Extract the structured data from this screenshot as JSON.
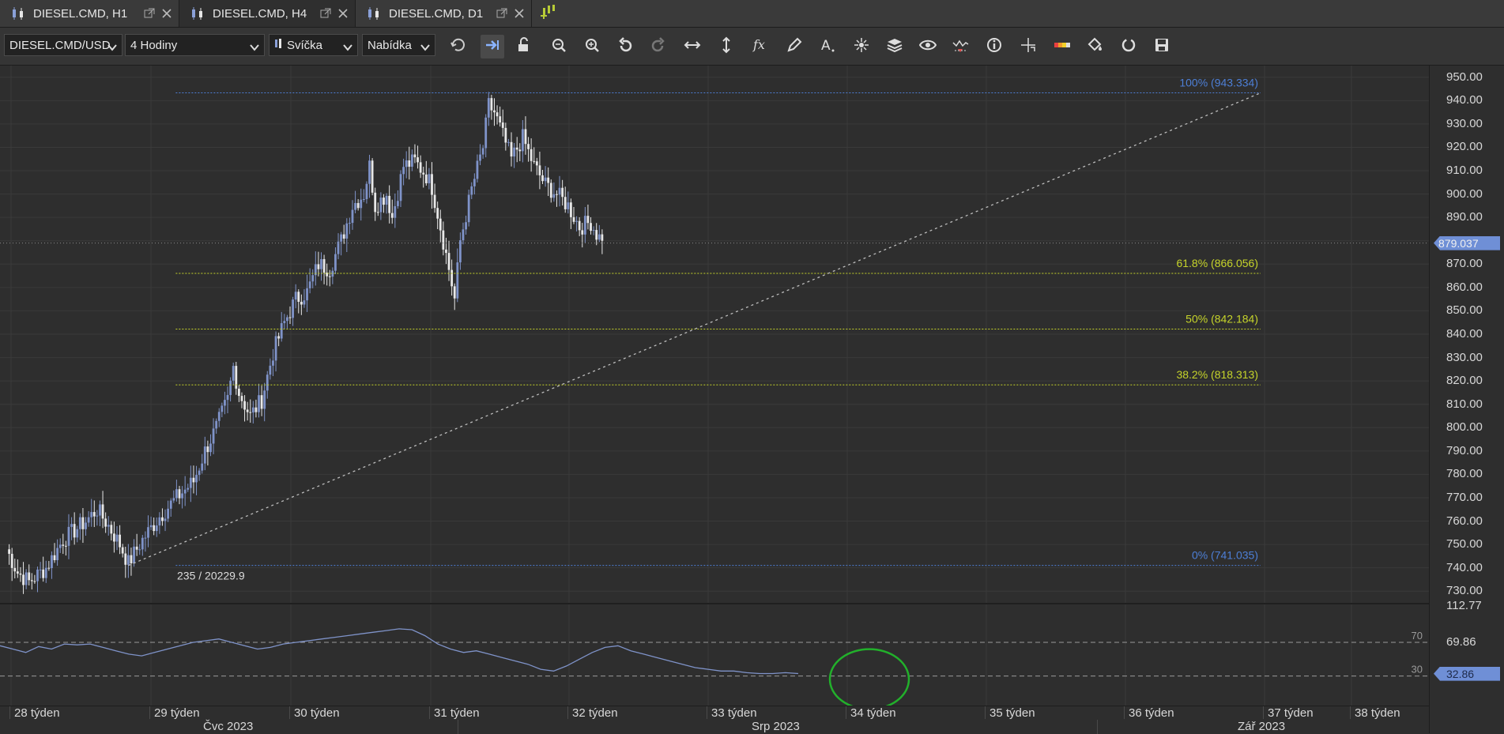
{
  "tabs": [
    {
      "label": "DIESEL.CMD, H1",
      "active": false
    },
    {
      "label": "DIESEL.CMD, H4",
      "active": true
    },
    {
      "label": "DIESEL.CMD, D1",
      "active": false
    }
  ],
  "toolbar": {
    "symbol": "DIESEL.CMD/USD",
    "timeframe": "4 Hodiny",
    "chart_type": "Svíčka",
    "price_side": "Nabídka",
    "icons": [
      "refresh-icon",
      "autoscroll-icon",
      "unlock-icon",
      "zoom-in-icon",
      "zoom-out-icon",
      "undo-icon",
      "redo-icon",
      "horizontal-scale-icon",
      "vertical-scale-icon",
      "function-icon",
      "pencil-icon",
      "text-icon",
      "objects-icon",
      "layers-icon",
      "eye-icon",
      "signal-icon",
      "info-icon",
      "crosshair-icon",
      "color-bar-icon",
      "paint-bucket-icon",
      "sync-icon",
      "save-icon"
    ]
  },
  "colors": {
    "bull": "#7f93c9",
    "bear": "#e8e8e8",
    "fib_blue": "#4d7fd6",
    "fib_yellow": "#c6d42a",
    "price_tag": "#6f8fd6",
    "circle": "#22b02b"
  },
  "chart_data": {
    "type": "candlestick",
    "symbol": "DIESEL.CMD/USD",
    "timeframe": "4 Hodiny",
    "ylim": [
      725,
      955
    ],
    "yticks": [
      "950.00",
      "940.00",
      "930.00",
      "920.00",
      "910.00",
      "900.00",
      "890.00",
      "880.00",
      "870.00",
      "860.00",
      "850.00",
      "840.00",
      "830.00",
      "820.00",
      "810.00",
      "800.00",
      "790.00",
      "780.00",
      "770.00",
      "760.00",
      "750.00",
      "740.00",
      "730.00"
    ],
    "current_price": "879.037",
    "fibonacci": [
      {
        "label": "100% (943.334)",
        "value": 943.334,
        "color": "blue"
      },
      {
        "label": "61.8% (866.056)",
        "value": 866.056,
        "color": "yellow"
      },
      {
        "label": "50% (842.184)",
        "value": 842.184,
        "color": "yellow"
      },
      {
        "label": "38.2% (818.313)",
        "value": 818.313,
        "color": "yellow"
      },
      {
        "label": "0% (741.035)",
        "value": 741.035,
        "color": "blue"
      }
    ],
    "anchor_label": "235 / 20229.9",
    "trendline": {
      "from": {
        "candle": 43,
        "price": 741.0
      },
      "to": {
        "candle": 281,
        "price": 943.3
      }
    },
    "candles_anchors": [
      [
        0,
        748
      ],
      [
        4,
        738
      ],
      [
        8,
        734
      ],
      [
        14,
        740
      ],
      [
        20,
        752
      ],
      [
        28,
        760
      ],
      [
        32,
        765
      ],
      [
        36,
        758
      ],
      [
        40,
        750
      ],
      [
        43,
        742
      ],
      [
        48,
        752
      ],
      [
        54,
        762
      ],
      [
        60,
        770
      ],
      [
        66,
        777
      ],
      [
        70,
        790
      ],
      [
        74,
        800
      ],
      [
        78,
        812
      ],
      [
        80,
        826
      ],
      [
        82,
        815
      ],
      [
        86,
        805
      ],
      [
        90,
        812
      ],
      [
        94,
        832
      ],
      [
        98,
        845
      ],
      [
        102,
        855
      ],
      [
        106,
        858
      ],
      [
        110,
        870
      ],
      [
        114,
        868
      ],
      [
        118,
        880
      ],
      [
        122,
        895
      ],
      [
        126,
        900
      ],
      [
        128,
        912
      ],
      [
        130,
        895
      ],
      [
        134,
        900
      ],
      [
        136,
        890
      ],
      [
        140,
        912
      ],
      [
        144,
        914
      ],
      [
        148,
        908
      ],
      [
        150,
        903
      ],
      [
        152,
        892
      ],
      [
        154,
        880
      ],
      [
        156,
        868
      ],
      [
        158,
        855
      ],
      [
        160,
        880
      ],
      [
        164,
        902
      ],
      [
        168,
        920
      ],
      [
        170,
        938
      ],
      [
        172,
        935
      ],
      [
        175,
        925
      ],
      [
        178,
        915
      ],
      [
        182,
        924
      ],
      [
        186,
        912
      ],
      [
        190,
        904
      ],
      [
        194,
        900
      ],
      [
        198,
        895
      ],
      [
        202,
        886
      ],
      [
        206,
        888
      ],
      [
        208,
        883
      ],
      [
        210,
        880
      ]
    ]
  },
  "indicator": {
    "yticks": [
      "112.77",
      "69.86",
      "32.86"
    ],
    "level_high": "70",
    "level_low": "30",
    "current": "32.86",
    "ylim": [
      -5,
      115
    ],
    "values": [
      66,
      62,
      58,
      65,
      62,
      68,
      67,
      68,
      64,
      60,
      56,
      54,
      58,
      62,
      66,
      70,
      72,
      74,
      70,
      66,
      62,
      64,
      68,
      70,
      72,
      74,
      76,
      78,
      80,
      82,
      84,
      86,
      85,
      78,
      68,
      62,
      58,
      60,
      56,
      52,
      48,
      44,
      38,
      36,
      42,
      50,
      58,
      64,
      66,
      60,
      56,
      52,
      48,
      44,
      40,
      38,
      36,
      36,
      34,
      33,
      33,
      34,
      33
    ]
  },
  "xaxis": {
    "weeks": [
      {
        "label": "28 týden",
        "x": 18
      },
      {
        "label": "29 týden",
        "x": 195
      },
      {
        "label": "30 týden",
        "x": 372
      },
      {
        "label": "31 týden",
        "x": 549
      },
      {
        "label": "32 týden",
        "x": 724
      },
      {
        "label": "33 týden",
        "x": 900
      },
      {
        "label": "34 týden",
        "x": 1076
      },
      {
        "label": "35 týden",
        "x": 1252
      },
      {
        "label": "36 týden",
        "x": 1428
      },
      {
        "label": "37 týden",
        "x": 1604
      },
      {
        "label": "38 týden",
        "x": 1714
      }
    ],
    "months": [
      {
        "label": "Čvc 2023",
        "x": 257
      },
      {
        "label": "Srp 2023",
        "x": 951
      },
      {
        "label": "Zář 2023",
        "x": 1566
      }
    ]
  }
}
